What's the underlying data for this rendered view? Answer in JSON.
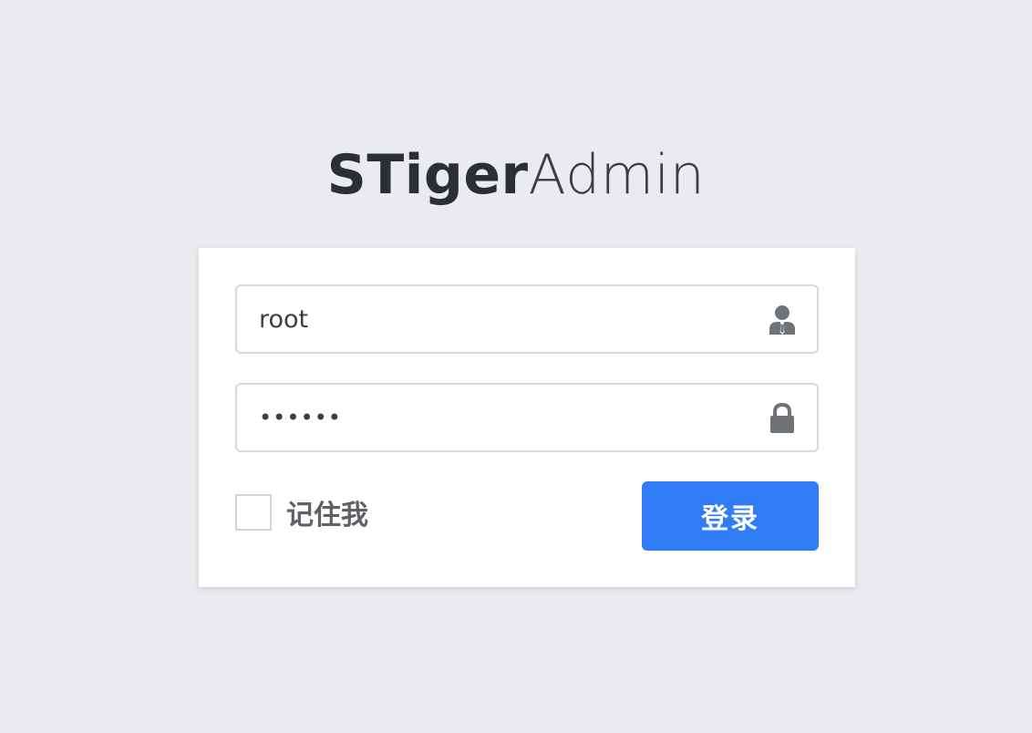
{
  "brand": {
    "bold_part": "STiger",
    "light_part": "Admin"
  },
  "login_form": {
    "username": {
      "value": "root",
      "icon": "user-icon"
    },
    "password": {
      "value": "••••••",
      "icon": "lock-icon"
    },
    "remember_label": "记住我",
    "remember_checked": false,
    "submit_label": "登录"
  },
  "colors": {
    "background": "#e9ebef",
    "card": "#ffffff",
    "primary_button": "#2f7cf6",
    "icon": "#6f7378"
  }
}
